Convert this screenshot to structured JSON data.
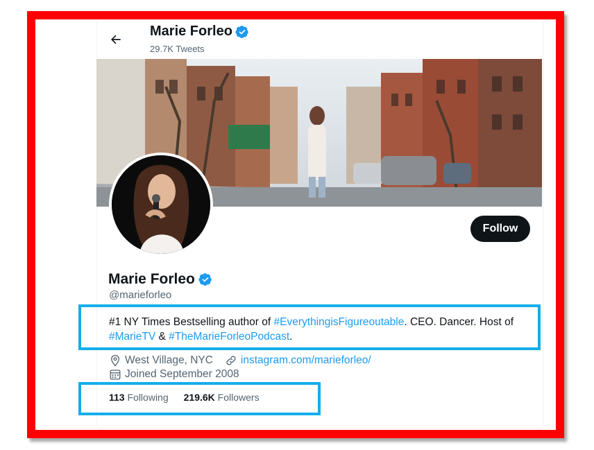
{
  "header": {
    "name": "Marie Forleo",
    "tweet_count": "29.7K Tweets"
  },
  "profile": {
    "display_name": "Marie Forleo",
    "handle": "@marieforleo",
    "follow_label": "Follow",
    "bio": {
      "part1": "#1 NY Times Bestselling author of ",
      "hashtag1": "#EverythingisFigureoutable",
      "part2": ". CEO. Dancer. Host of ",
      "hashtag2": "#MarieTV",
      "part3": " & ",
      "hashtag3": "#TheMarieForleoPodcast",
      "part4": "."
    },
    "location": "West Village, NYC",
    "website": "instagram.com/marieforleo/",
    "joined": "Joined September 2008",
    "following_count": "113",
    "following_label": "Following",
    "followers_count": "219.6K",
    "followers_label": "Followers"
  },
  "colors": {
    "outer_frame": "#ff0000",
    "highlight_box": "#14aeea",
    "link": "#1d9bf0",
    "verified": "#1d9bf0"
  }
}
